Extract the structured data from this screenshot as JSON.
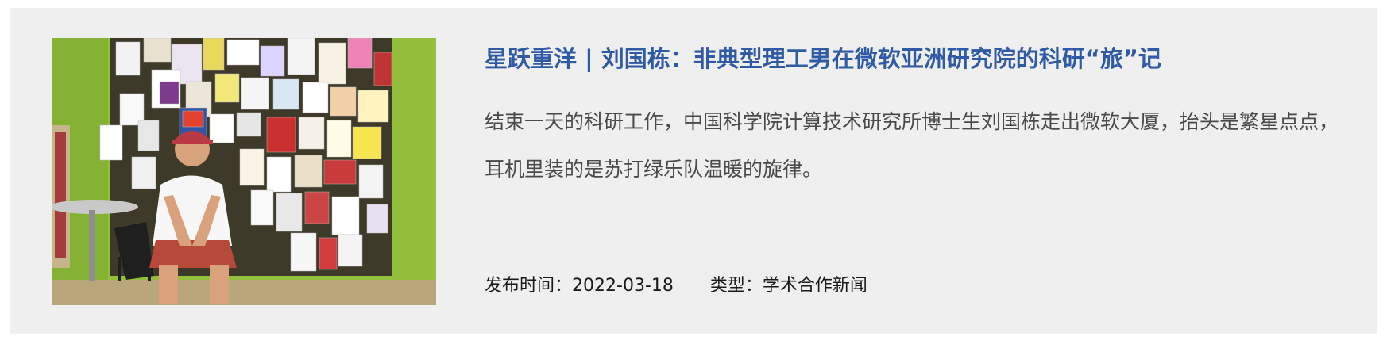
{
  "article": {
    "title": "星跃重洋 | 刘国栋：非典型理工男在微软亚洲研究院的科研“旅”记",
    "summary": "结束一天的科研工作，中国科学院计算技术研究所博士生刘国栋走出微软大厦，抬头是繁星点点，耳机里装的是苏打绿乐队温暖的旋律。",
    "publish_label": "发布时间：",
    "publish_date": "2022-03-18",
    "type_label": "类型：",
    "type_value": "学术合作新闻",
    "thumbnail": "photo of a young man in a white t-shirt and red cap sitting in front of a bulletin board covered with posters"
  },
  "colors": {
    "title": "#2f5aa5",
    "card_bg": "#efefef",
    "text": "#4a4a4a",
    "wall": "#8fbb3a"
  }
}
